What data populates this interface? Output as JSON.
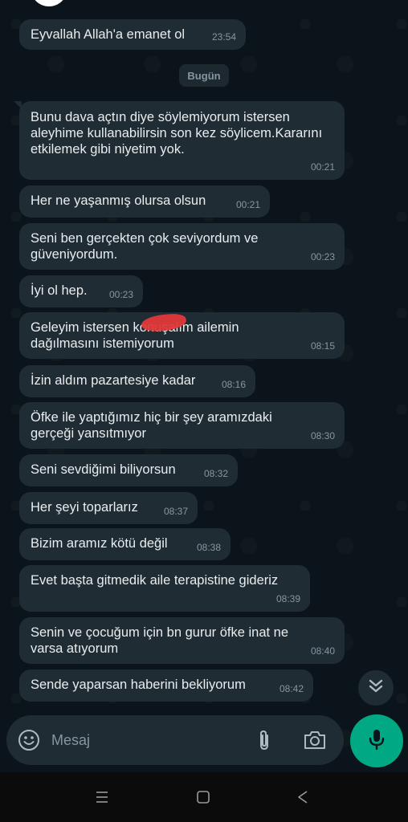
{
  "date_separator": "Bugün",
  "messages": [
    {
      "text": "Eyvallah Allah'a emanet ol",
      "time": "23:54"
    },
    {
      "text": "Bunu dava açtın diye söylemiyorum istersen aleyhime kullanabilirsin son kez söylicem.Kararını etkilemek gibi niyetim yok.",
      "time": "00:21"
    },
    {
      "text": "Her ne yaşanmış olursa olsun",
      "time": "00:21"
    },
    {
      "text": "Seni ben gerçekten çok seviyordum ve güveniyordum.",
      "time": "00:23"
    },
    {
      "text": "İyi ol hep.",
      "time": "00:23"
    },
    {
      "text": "Geleyim istersen konuşalım ailemin dağılmasını istemiyorum",
      "time": "08:15"
    },
    {
      "text": "İzin aldım pazartesiye kadar",
      "time": "08:16"
    },
    {
      "text": "Öfke ile yaptığımız hiç bir şey  aramızdaki gerçeği yansıtmıyor",
      "time": "08:30"
    },
    {
      "text": "Seni sevdiğimi biliyorsun",
      "time": "08:32"
    },
    {
      "text": "Her şeyi toparlarız",
      "time": "08:37"
    },
    {
      "text": "Bizim aramız kötü değil",
      "time": "08:38"
    },
    {
      "text": "Evet başta gitmedik aile terapistine gideriz",
      "time": "08:39"
    },
    {
      "text": "Senin ve çocuğum için bn gurur öfke inat ne varsa atıyorum",
      "time": "08:40"
    },
    {
      "text": "Sende yaparsan haberini bekliyorum",
      "time": "08:42"
    }
  ],
  "composer": {
    "placeholder": "Mesaj"
  },
  "icons": {
    "emoji": "emoji-icon",
    "attach": "paperclip-icon",
    "camera": "camera-icon",
    "mic": "microphone-icon",
    "scroll_down": "double-chevron-down-icon",
    "nav_recents": "recents-icon",
    "nav_home": "home-icon",
    "nav_back": "back-icon"
  },
  "colors": {
    "background": "#0b141a",
    "bubble_incoming": "#202c33",
    "text_primary": "#e9edef",
    "text_secondary": "#8696a0",
    "accent_green": "#00a884",
    "redaction_red": "#e0393a"
  }
}
